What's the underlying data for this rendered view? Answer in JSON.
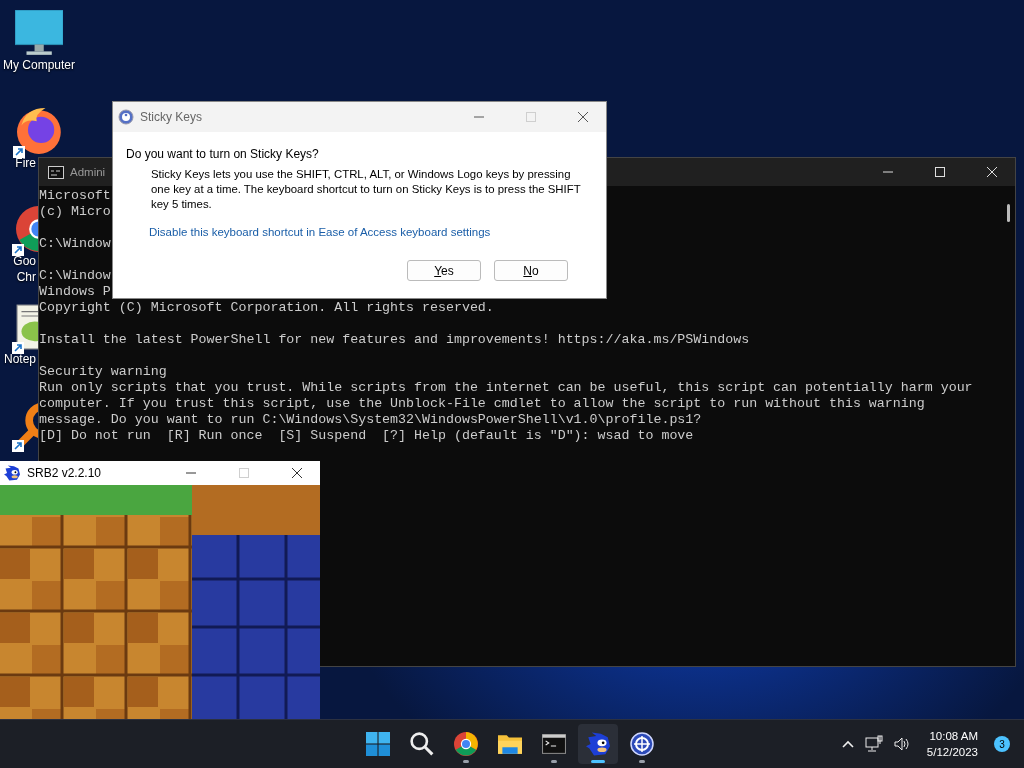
{
  "desktop_icons": [
    {
      "kind": "computer",
      "label_lines": [
        "My Computer"
      ],
      "shortcut": false
    },
    {
      "kind": "firefox",
      "label_lines": [
        "Fire"
      ],
      "shortcut": true
    },
    {
      "kind": "chrome",
      "label_lines": [
        "Goo",
        "Chr"
      ],
      "shortcut": true
    },
    {
      "kind": "notepad",
      "label_lines": [
        "Notep"
      ],
      "shortcut": true
    },
    {
      "kind": "orange-app",
      "shortcut": true
    }
  ],
  "console_window": {
    "title": "Admini",
    "blocks": [
      {
        "kind": "text",
        "lines": [
          "Microsoft",
          "(c) Micro"
        ]
      },
      {
        "kind": "text",
        "lines": [
          "C:\\Window"
        ]
      },
      {
        "kind": "text",
        "lines": [
          "C:\\Window",
          "Windows P",
          "Copyright (C) Microsoft Corporation. All rights reserved."
        ]
      },
      {
        "kind": "text",
        "lines": [
          "Install the latest PowerShell for new features and improvements! https://aka.ms/PSWindows"
        ]
      },
      {
        "kind": "warning",
        "lines": [
          "Security warning",
          "Run only scripts that you trust. While scripts from the internet can be useful, this script can potentially harm your",
          "computer. If you trust this script, use the Unblock-File cmdlet to allow the script to run without this warning",
          "message. Do you want to run C:\\Windows\\System32\\WindowsPowerShell\\v1.0\\profile.ps1?",
          "[D] Do not run  [R] Run once  [S] Suspend  [?] Help (default is \"D\"): wsad to move"
        ]
      }
    ]
  },
  "dialog": {
    "title": "Sticky Keys",
    "maximize_disabled": true,
    "question": "Do you want to turn on Sticky Keys?",
    "body": "Sticky Keys lets you use the SHIFT, CTRL, ALT, or Windows Logo keys by pressing one key at a time. The keyboard shortcut to turn on Sticky Keys is to press the SHIFT key 5 times.",
    "link": "Disable this keyboard shortcut in Ease of Access keyboard settings",
    "buttons": [
      {
        "label": "Yes",
        "mnemonic": true
      },
      {
        "label": "No",
        "mnemonic": true
      }
    ]
  },
  "game_window": {
    "title": "SRB2 v2.2.10",
    "maximize_disabled": true
  },
  "taskbar": {
    "apps": [
      {
        "kind": "start",
        "running": false,
        "selected": false
      },
      {
        "kind": "search",
        "running": false,
        "selected": false
      },
      {
        "kind": "chrome",
        "running": true,
        "selected": false
      },
      {
        "kind": "folder",
        "running": false,
        "selected": false
      },
      {
        "kind": "terminal",
        "running": true,
        "selected": false
      },
      {
        "kind": "hedgehog",
        "running": true,
        "selected": true
      },
      {
        "kind": "blue-app",
        "running": true,
        "selected": false
      }
    ],
    "time": "10:08 AM",
    "date": "5/12/2023",
    "notification_count": "3"
  }
}
